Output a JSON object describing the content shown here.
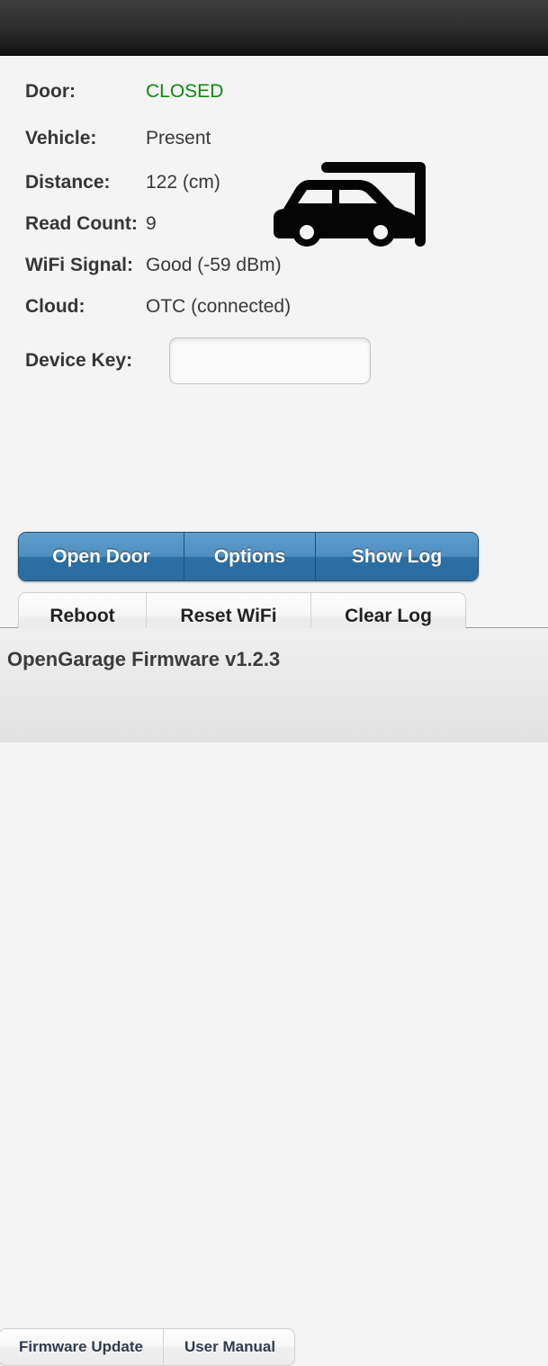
{
  "header": {
    "title": ""
  },
  "status": {
    "rows": [
      {
        "label": "Door:",
        "value": "CLOSED",
        "state": "green"
      },
      {
        "label": "Vehicle:",
        "value": "Present",
        "state": "normal"
      },
      {
        "label": "Distance:",
        "value": "122 (cm)",
        "state": "normal"
      },
      {
        "label": "Read Count:",
        "value": "9",
        "state": "normal"
      },
      {
        "label": "WiFi Signal:",
        "value": "Good (-59 dBm)",
        "state": "normal"
      },
      {
        "label": "Cloud:",
        "value": "OTC (connected)",
        "state": "normal"
      }
    ],
    "device_key": {
      "label": "Device Key:",
      "value": "",
      "placeholder": ""
    }
  },
  "icons": {
    "vehicle": "car-in-garage-icon"
  },
  "primary_buttons": [
    {
      "label": "Open Door"
    },
    {
      "label": "Options"
    },
    {
      "label": "Show Log"
    }
  ],
  "secondary_buttons": [
    {
      "label": "Reboot"
    },
    {
      "label": "Reset WiFi"
    },
    {
      "label": "Clear Log"
    }
  ],
  "footer": {
    "title": "OpenGarage Firmware v1.2.3",
    "buttons": [
      {
        "label": "Firmware Update"
      },
      {
        "label": "User Manual"
      }
    ]
  },
  "colors": {
    "status_ok": "#0b8a0b",
    "primary_button": "#4f8ec0",
    "header_bg": "#303030",
    "content_bg": "#f4f4f4"
  }
}
